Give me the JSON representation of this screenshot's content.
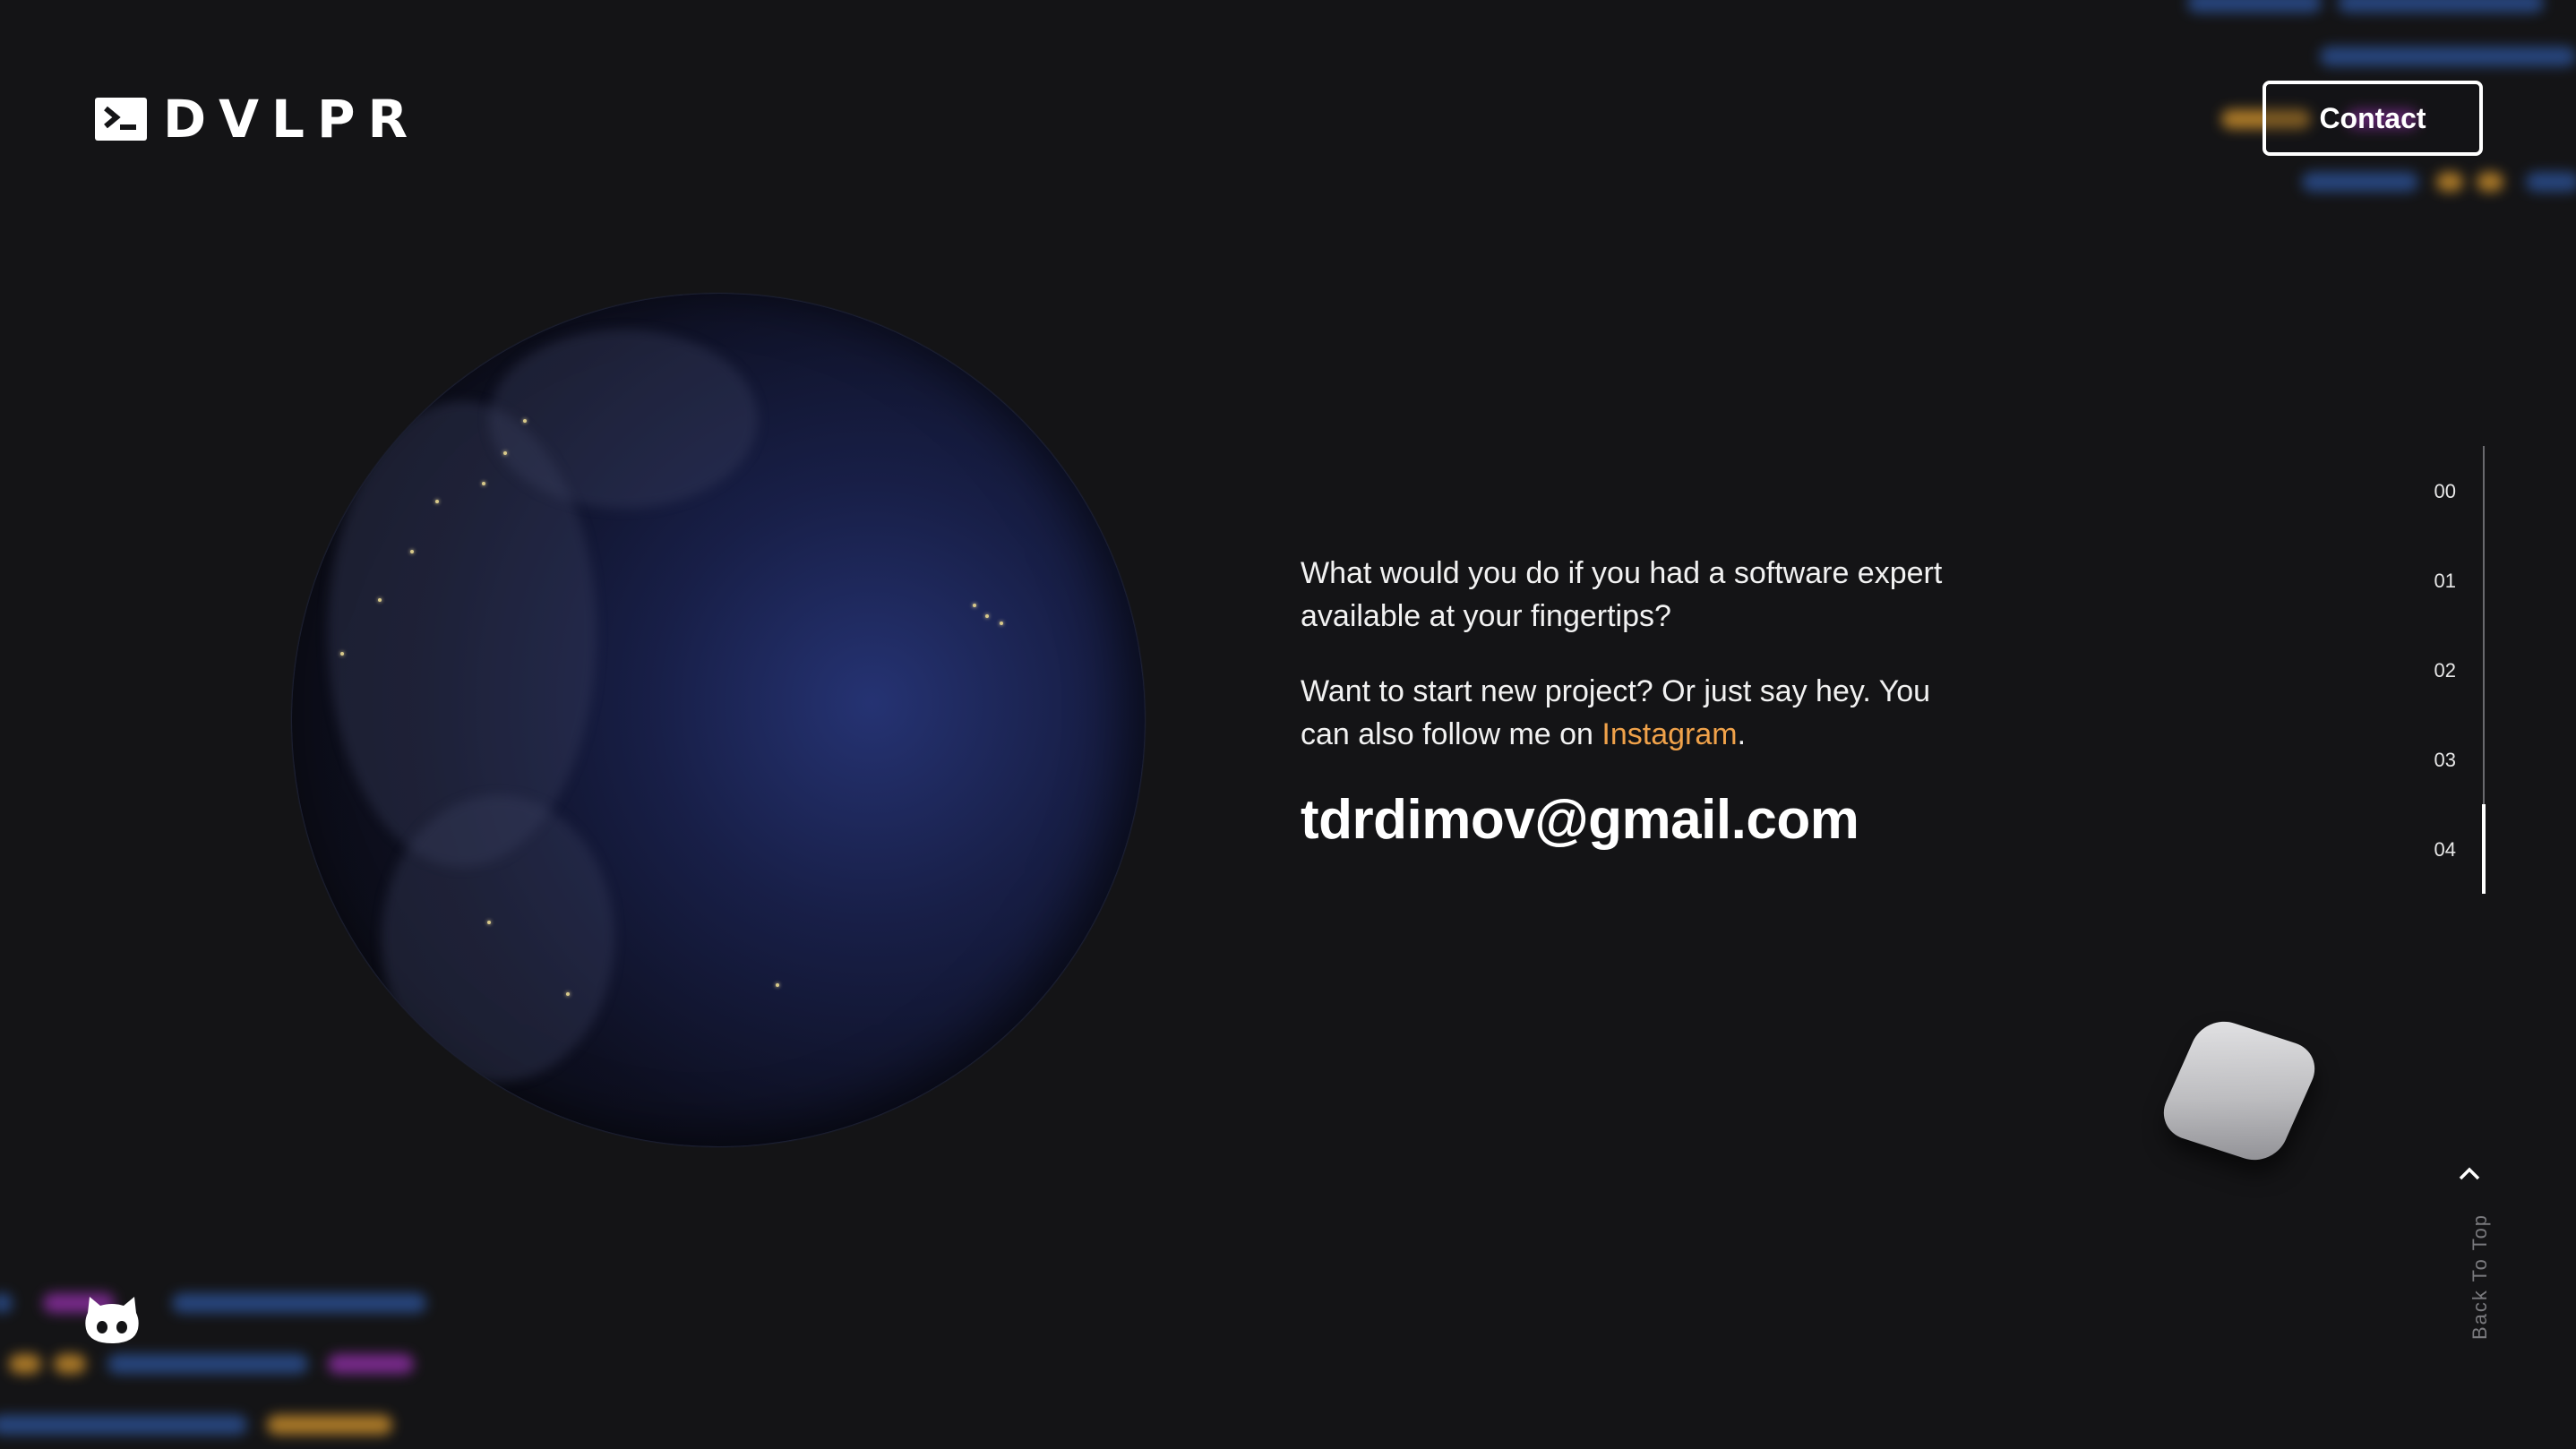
{
  "header": {
    "logo_text": "DVLPR",
    "contact_label": "Contact"
  },
  "main": {
    "paragraph1": "What would you do if you had a software expert available at your fingertips?",
    "paragraph2_prefix": "Want to start new project? Or just say hey. You can also follow me on ",
    "paragraph2_link": "Instagram",
    "paragraph2_suffix": ".",
    "email": "tdrdimov@gmail.com"
  },
  "section_nav": {
    "items": [
      "00",
      "01",
      "02",
      "03",
      "04"
    ],
    "active_index": 4
  },
  "back_to_top": {
    "label": "Back To Top"
  },
  "colors": {
    "background": "#141416",
    "accent_link": "#f0a24a",
    "text": "#ffffff"
  },
  "icons": {
    "logo": "terminal-icon",
    "social": "github-icon",
    "back_to_top": "chevron-up-icon"
  }
}
